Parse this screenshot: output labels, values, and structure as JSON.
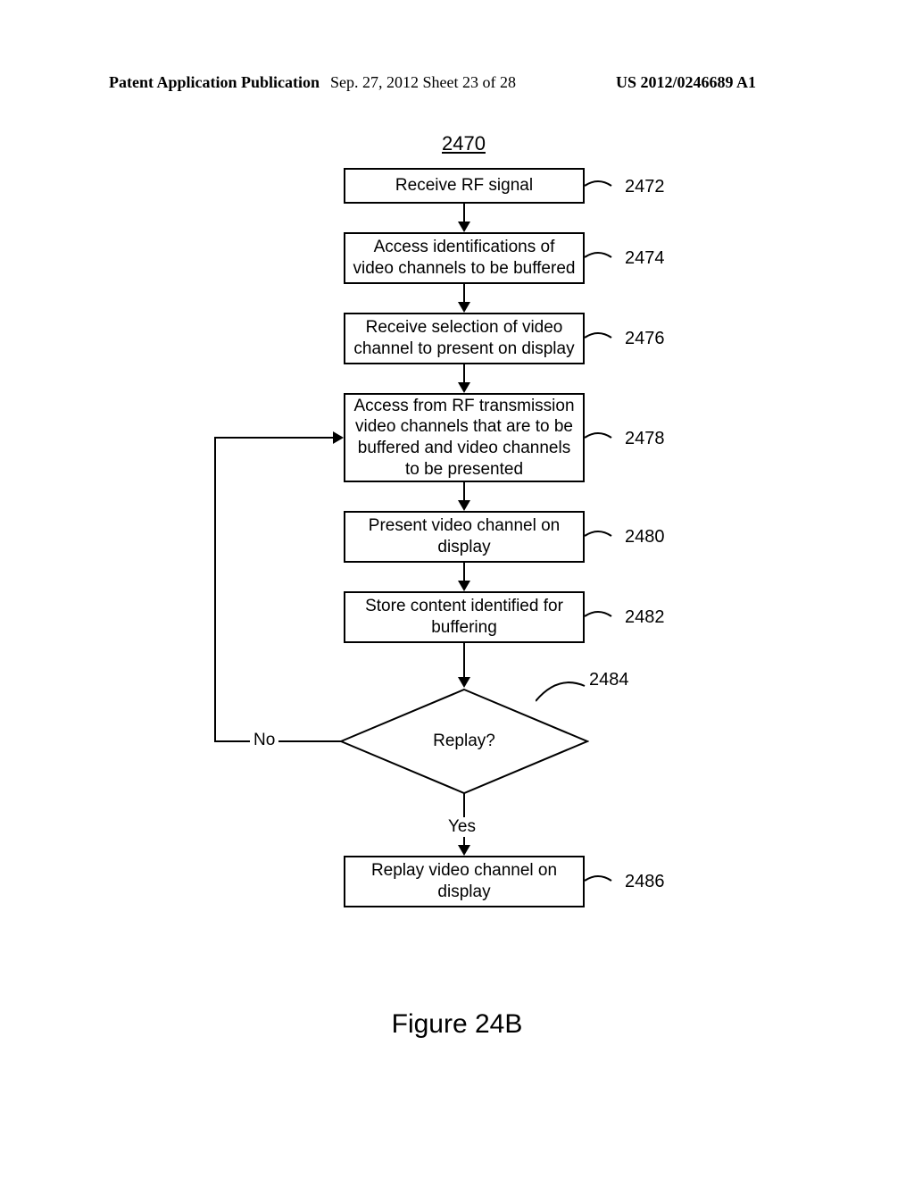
{
  "header": {
    "left": "Patent Application Publication",
    "mid": "Sep. 27, 2012  Sheet 23 of 28",
    "right": "US 2012/0246689 A1"
  },
  "fignum": "2470",
  "caption": "Figure 24B",
  "boxes": {
    "b1": "Receive RF signal",
    "b2": "Access identifications of video channels to be buffered",
    "b3": "Receive selection of video channel to present on display",
    "b4": "Access from RF transmission video channels that are to be buffered and video channels to be presented",
    "b5": "Present video channel on display",
    "b6": "Store content identified for buffering",
    "b7": "Replay video channel on display",
    "d1": "Replay?"
  },
  "refs": {
    "r1": "2472",
    "r2": "2474",
    "r3": "2476",
    "r4": "2478",
    "r5": "2480",
    "r6": "2482",
    "r7": "2486",
    "rd": "2484"
  },
  "branches": {
    "no": "No",
    "yes": "Yes"
  }
}
